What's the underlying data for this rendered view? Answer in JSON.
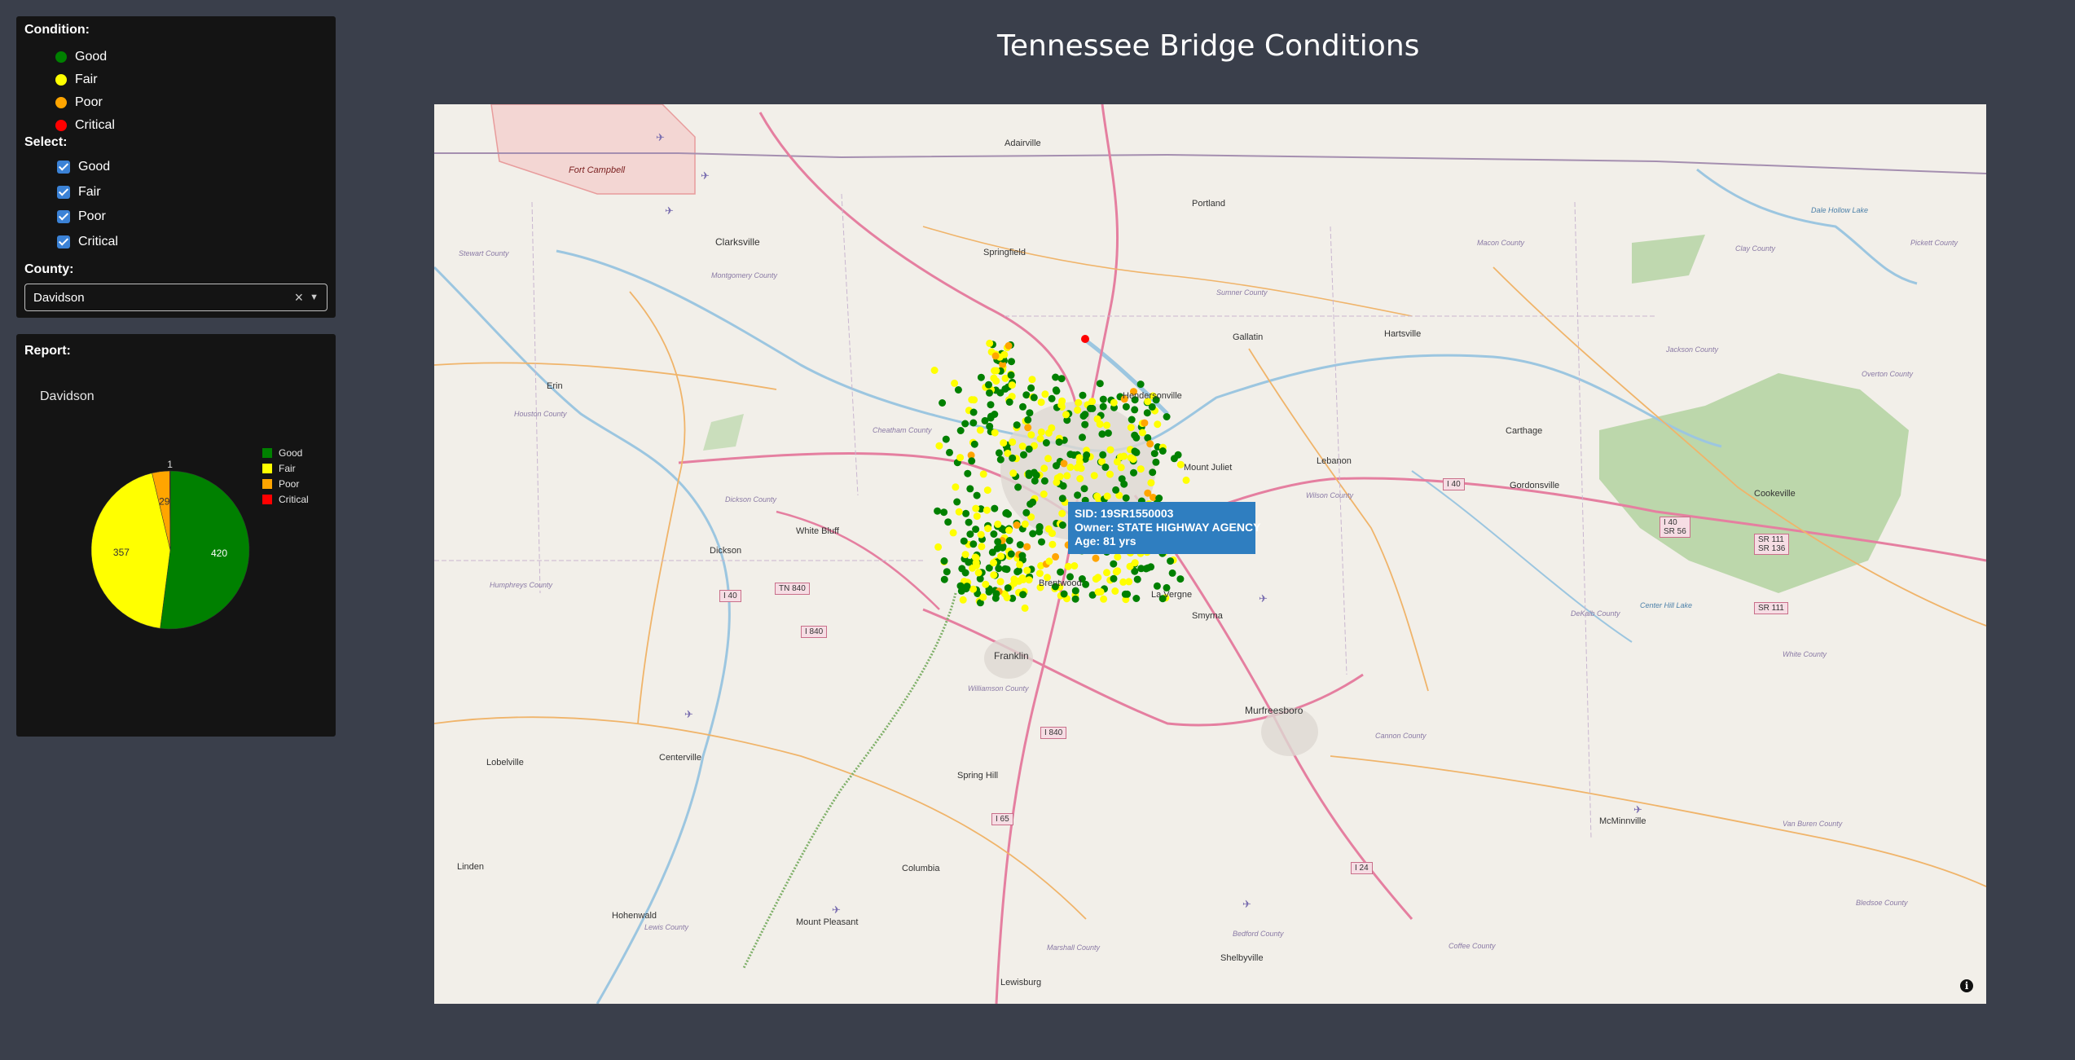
{
  "page": {
    "title": "Tennessee Bridge Conditions"
  },
  "filters": {
    "condition_header": "Condition:",
    "legend": [
      {
        "label": "Good",
        "color": "#008000"
      },
      {
        "label": "Fair",
        "color": "#ffff00"
      },
      {
        "label": "Poor",
        "color": "#ffa500"
      },
      {
        "label": "Critical",
        "color": "#ff0000"
      }
    ],
    "select_header": "Select:",
    "checkboxes": [
      {
        "label": "Good",
        "checked": true
      },
      {
        "label": "Fair",
        "checked": true
      },
      {
        "label": "Poor",
        "checked": true
      },
      {
        "label": "Critical",
        "checked": true
      }
    ],
    "county_header": "County:",
    "county_value": "Davidson"
  },
  "report": {
    "header": "Report:",
    "chart_title": "Davidson"
  },
  "chart_data": {
    "type": "pie",
    "title": "Davidson",
    "slices": [
      {
        "label": "Good",
        "value": 420,
        "color": "#008000"
      },
      {
        "label": "Fair",
        "value": 357,
        "color": "#ffff00"
      },
      {
        "label": "Poor",
        "value": 29,
        "color": "#ffa500"
      },
      {
        "label": "Critical",
        "value": 1,
        "color": "#ff0000"
      }
    ],
    "legend": [
      "Good",
      "Fair",
      "Poor",
      "Critical"
    ],
    "legend_position": "right"
  },
  "map": {
    "tooltip": {
      "sid": "SID: 19SR1550003",
      "owner": "Owner: STATE HIGHWAY AGENCY",
      "age": "Age: 81 yrs"
    },
    "places": {
      "adairville": "Adairville",
      "fort_campbell": "Fort Campbell",
      "portland": "Portland",
      "clarksville": "Clarksville",
      "springfield": "Springfield",
      "stewart_county": "Stewart County",
      "montgomery_county": "Montgomery County",
      "sumner_county": "Sumner County",
      "macon_county": "Macon County",
      "clay_county": "Clay County",
      "pickett_county": "Pickett County",
      "dale_hollow_lake": "Dale Hollow Lake",
      "gallatin": "Gallatin",
      "hartsville": "Hartsville",
      "jackson_county": "Jackson County",
      "overton_county": "Overton County",
      "erin": "Erin",
      "houston_county": "Houston County",
      "hendersonville": "Hendersonville",
      "cheatham_county": "Cheatham County",
      "carthage": "Carthage",
      "mount_juliet": "Mount Juliet",
      "lebanon": "Lebanon",
      "wilson_county": "Wilson County",
      "gordonsville": "Gordonsville",
      "cookeville": "Cookeville",
      "dickson_county": "Dickson County",
      "white_bluff": "White Bluff",
      "dickson": "Dickson",
      "humphreys_county": "Humphreys County",
      "brentwood": "Brentwood",
      "la_vergne": "La Vergne",
      "smyrna": "Smyrna",
      "center_hill_lake": "Center Hill Lake",
      "dekalb_county": "DeKalb County",
      "white_county": "White County",
      "franklin": "Franklin",
      "williamson_county": "Williamson County",
      "murfreesboro": "Murfreesboro",
      "cannon_county": "Cannon County",
      "lobelville": "Lobelville",
      "centerville": "Centerville",
      "spring_hill": "Spring Hill",
      "mcminnville": "McMinnville",
      "van_buren_county": "Van Buren County",
      "linden": "Linden",
      "columbia": "Columbia",
      "hohenwald": "Hohenwald",
      "lewis_county": "Lewis County",
      "mount_pleasant": "Mount Pleasant",
      "marshall_county": "Marshall County",
      "bedford_county": "Bedford County",
      "coffee_county": "Coffee County",
      "bledsoe_county": "Bledsoe County",
      "shelbyville": "Shelbyville",
      "lewisburg": "Lewisburg"
    },
    "shields": {
      "i40_west": "I 40",
      "tn840": "TN 840",
      "i840_west": "I 840",
      "i840_south": "I 840",
      "i65": "I 65",
      "i24": "I 24",
      "i40_east": "I 40",
      "i40_sr56_a": "I 40",
      "i40_sr56_b": "SR 56",
      "sr111_a": "SR 111",
      "sr111_b": "SR 136",
      "sr111_c": "SR 111"
    }
  }
}
